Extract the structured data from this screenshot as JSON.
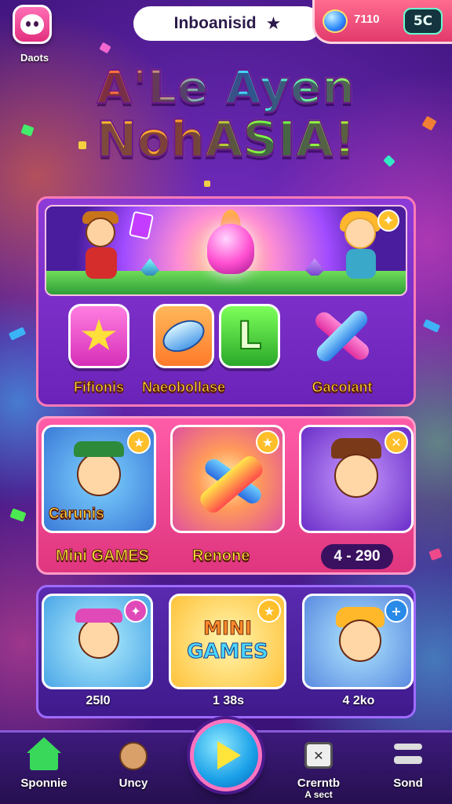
{
  "header": {
    "logo_label": "Daots",
    "title": "Inboanisid",
    "currency_value": "7110",
    "currency_badge": "5C"
  },
  "headline": {
    "line1": "A'Le Ayen",
    "line2": "NohASIA!"
  },
  "modes": [
    {
      "label": "Fifionis",
      "icon": "star-icon"
    },
    {
      "label": "Naeobollase",
      "icon": "leaf-icon"
    },
    {
      "label": "",
      "icon": "letter-l-icon"
    },
    {
      "label": "Gacoiant",
      "icon": "cross-bars-icon"
    }
  ],
  "games": {
    "tile1_caption": "Carunis",
    "label_left": "Mini GAMES",
    "label_mid": "Renone",
    "score": "4 - 290"
  },
  "bottom_tiles": {
    "tile2_line1": "MINI",
    "tile2_line2": "GAMES",
    "label1": "25l0",
    "label2": "1 38s",
    "label3": "4 2ko"
  },
  "nav": {
    "item1": "Sponnie",
    "item2": "Uncy",
    "item3_line1": "Crerntb",
    "item3_line2": "A sect",
    "item4": "Sond"
  },
  "colors": {
    "accent_pink": "#ff5ca8",
    "accent_gold": "#ffbf2a",
    "background_purple": "#5a23a8"
  }
}
